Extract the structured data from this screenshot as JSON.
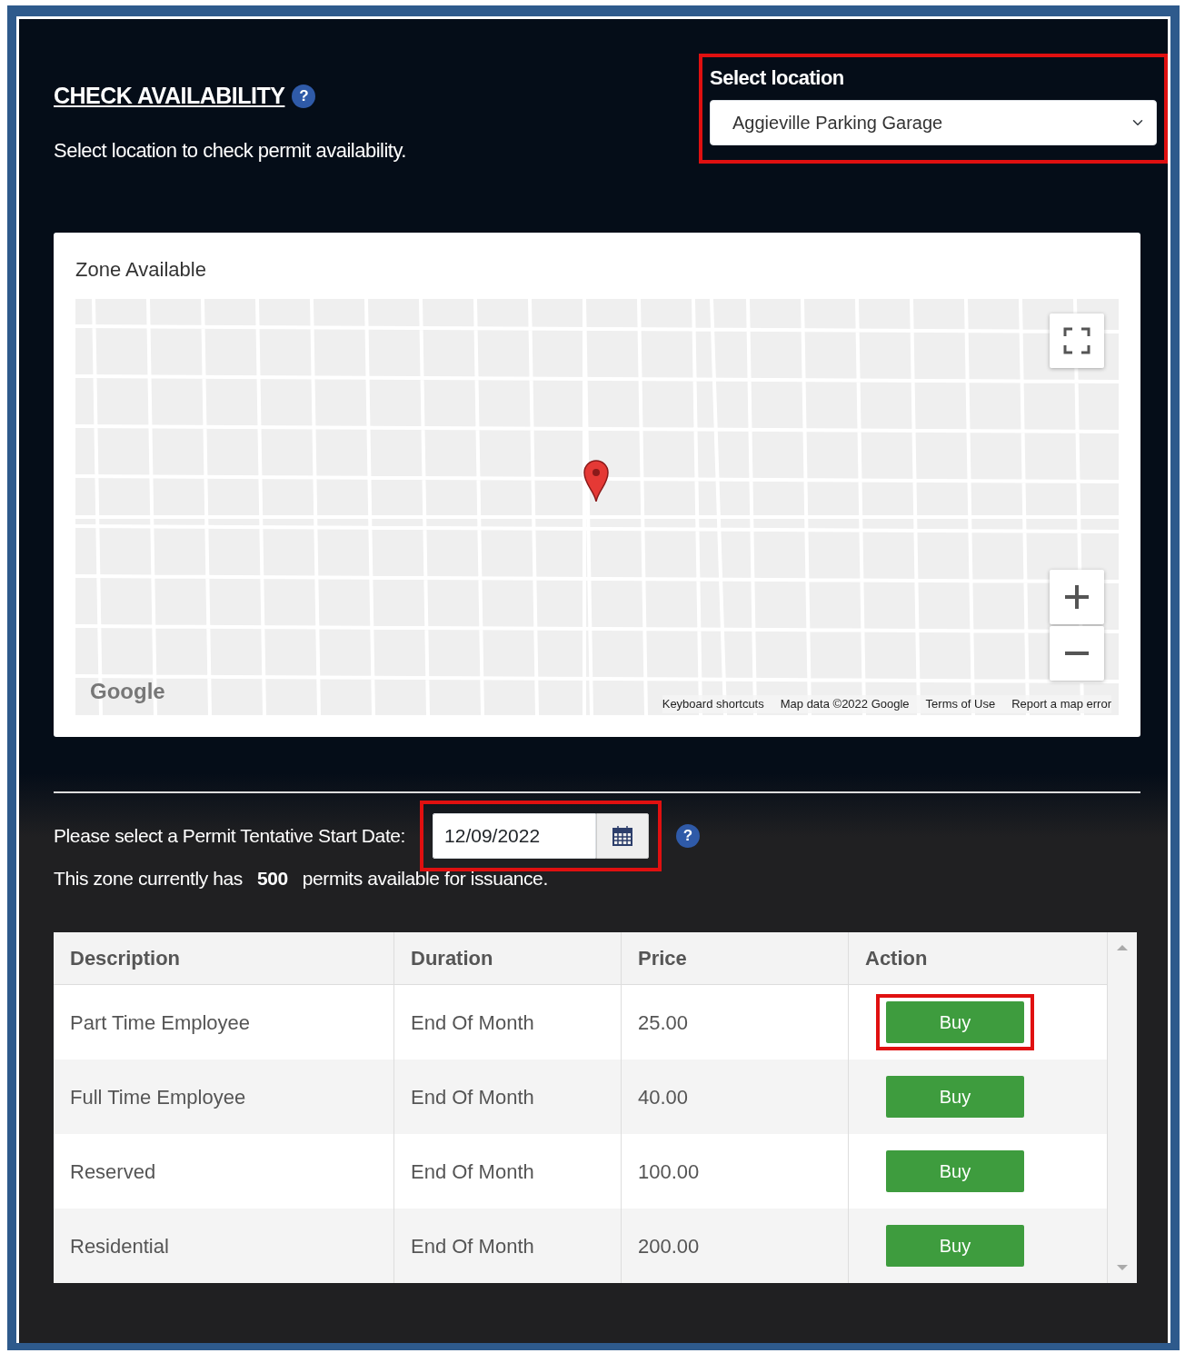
{
  "header": {
    "title": "CHECK AVAILABILITY",
    "help": "?",
    "subtitle": "Select location to check permit availability."
  },
  "location": {
    "label": "Select location",
    "value": "Aggieville Parking Garage"
  },
  "map_card": {
    "title": "Zone Available",
    "logo": "Google",
    "footer_links": [
      "Keyboard shortcuts",
      "Map data ©2022 Google",
      "Terms of Use",
      "Report a map error"
    ]
  },
  "start_date": {
    "label": "Please select a Permit Tentative Start Date:",
    "value": "12/09/2022",
    "help": "?"
  },
  "availability": {
    "before": "This zone currently has",
    "count": "500",
    "after": "permits available for issuance."
  },
  "table": {
    "columns": [
      "Description",
      "Duration",
      "Price",
      "Action"
    ],
    "rows": [
      {
        "description": "Part Time Employee",
        "duration": "End Of Month",
        "price": "25.00",
        "action": "Buy",
        "highlighted": true
      },
      {
        "description": "Full Time Employee",
        "duration": "End Of Month",
        "price": "40.00",
        "action": "Buy",
        "highlighted": false
      },
      {
        "description": "Reserved",
        "duration": "End Of Month",
        "price": "100.00",
        "action": "Buy",
        "highlighted": false
      },
      {
        "description": "Residential",
        "duration": "End Of Month",
        "price": "200.00",
        "action": "Buy",
        "highlighted": false
      }
    ]
  }
}
